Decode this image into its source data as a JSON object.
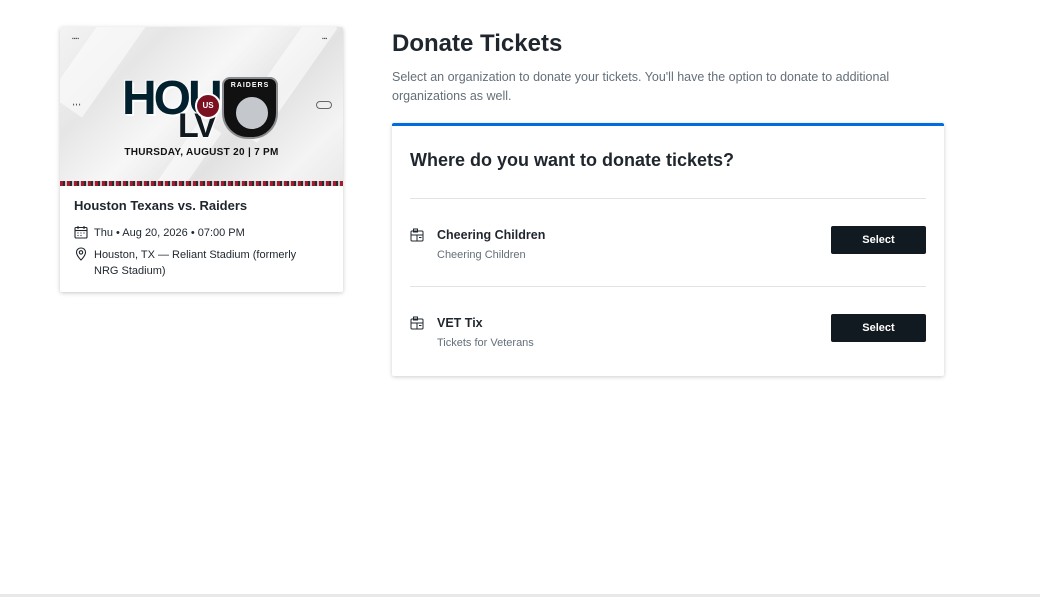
{
  "event": {
    "banner": {
      "home_logo_text": "HOU",
      "lv_text": "LV",
      "badge_text": "US",
      "away_logo_text": "RAIDERS",
      "date_text": "THURSDAY, AUGUST 20 | 7 PM",
      "colors": {
        "home_navy": "#03202f",
        "home_red": "#c8102e",
        "away_black": "#111111",
        "away_silver": "#c4c8cc"
      }
    },
    "title": "Houston Texans vs. Raiders",
    "datetime": "Thu • Aug 20, 2026 • 07:00 PM",
    "location": "Houston, TX — Reliant Stadium (formerly NRG Stadium)",
    "icons": {
      "date": "calendar-icon",
      "location": "map-pin-icon"
    }
  },
  "page": {
    "title": "Donate Tickets",
    "subtitle": "Select an organization to donate your tickets. You'll have the option to donate to additional organizations as well."
  },
  "panel": {
    "heading": "Where do you want to donate tickets?",
    "accent_color": "#026cdf",
    "organizations": [
      {
        "name": "Cheering Children",
        "description": "Cheering Children",
        "button_label": "Select",
        "icon": "organization-icon"
      },
      {
        "name": "VET Tix",
        "description": "Tickets for Veterans",
        "button_label": "Select",
        "icon": "organization-icon"
      }
    ]
  }
}
